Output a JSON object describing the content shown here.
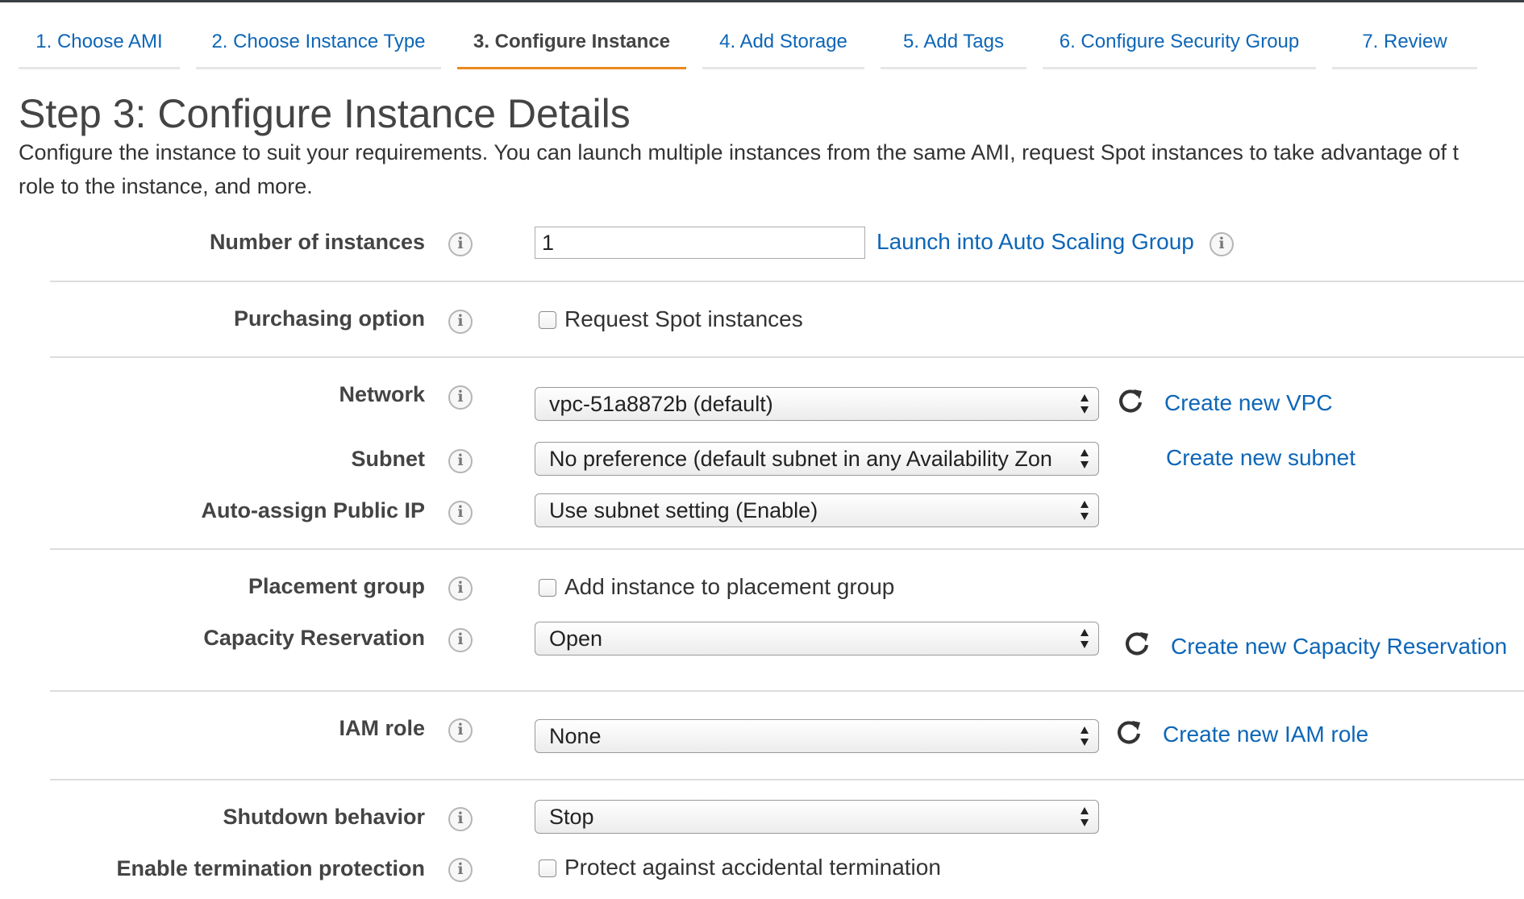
{
  "wizard": {
    "tabs": [
      {
        "label": "1. Choose AMI",
        "active": false
      },
      {
        "label": "2. Choose Instance Type",
        "active": false
      },
      {
        "label": "3. Configure Instance",
        "active": true
      },
      {
        "label": "4. Add Storage",
        "active": false
      },
      {
        "label": "5. Add Tags",
        "active": false
      },
      {
        "label": "6. Configure Security Group",
        "active": false
      },
      {
        "label": "7. Review",
        "active": false
      }
    ]
  },
  "page": {
    "title": "Step 3: Configure Instance Details",
    "description_line1": "Configure the instance to suit your requirements. You can launch multiple instances from the same AMI, request Spot instances to take advantage of t",
    "description_line2": "role to the instance, and more."
  },
  "form": {
    "number_of_instances": {
      "label": "Number of instances",
      "value": "1",
      "link": "Launch into Auto Scaling Group"
    },
    "purchasing_option": {
      "label": "Purchasing option",
      "checkbox_label": "Request Spot instances",
      "checked": false
    },
    "network": {
      "label": "Network",
      "value": "vpc-51a8872b (default)",
      "link": "Create new VPC"
    },
    "subnet": {
      "label": "Subnet",
      "value": "No preference (default subnet in any Availability Zon",
      "link": "Create new subnet"
    },
    "auto_assign_ip": {
      "label": "Auto-assign Public IP",
      "value": "Use subnet setting (Enable)"
    },
    "placement_group": {
      "label": "Placement group",
      "checkbox_label": "Add instance to placement group",
      "checked": false
    },
    "capacity_reservation": {
      "label": "Capacity Reservation",
      "value": "Open",
      "link": "Create new Capacity Reservation"
    },
    "iam_role": {
      "label": "IAM role",
      "value": "None",
      "link": "Create new IAM role"
    },
    "shutdown_behavior": {
      "label": "Shutdown behavior",
      "value": "Stop"
    },
    "termination_protection": {
      "label": "Enable termination protection",
      "checkbox_label": "Protect against accidental termination",
      "checked": false
    }
  },
  "icons": {
    "info": "info-circle-icon",
    "refresh": "refresh-icon",
    "select_arrows": "up-down-arrows-icon"
  },
  "colors": {
    "link": "#0d66b7",
    "active_tab_underline": "#ec8a1f",
    "label_text": "#444444"
  }
}
